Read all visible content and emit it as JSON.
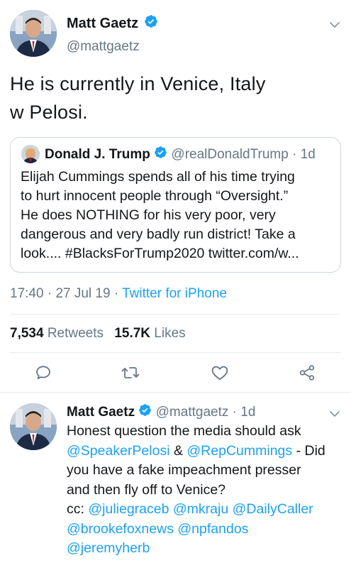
{
  "main_tweet": {
    "author_name": "Matt Gaetz",
    "author_handle": "@mattgaetz",
    "text_line1": "He is currently in Venice, Italy",
    "text_line2": "w Pelosi.",
    "time": "17:40",
    "date": "27 Jul 19",
    "separator": "·",
    "source": "Twitter for iPhone",
    "retweets_count": "7,534",
    "retweets_label": "Retweets",
    "likes_count": "15.7K",
    "likes_label": "Likes"
  },
  "quoted_tweet": {
    "author_name": "Donald J. Trump",
    "author_handle": "@realDonaldTrump",
    "age": "1d",
    "separator": "·",
    "lines": [
      "Elijah Cummings spends all of his time trying",
      "to hurt innocent people through “Oversight.”",
      "He does NOTHING for his very poor, very",
      "dangerous and very badly run district! Take a",
      "look.... #BlacksForTrump2020 twitter.com/w..."
    ]
  },
  "reply_tweet": {
    "author_name": "Matt Gaetz",
    "author_handle": "@mattgaetz",
    "age": "1d",
    "separator": "·",
    "line1": "Honest question the media should ask",
    "line2_mention1": "@SpeakerPelosi",
    "line2_amp": " & ",
    "line2_mention2": "@RepCummings",
    "line2_tail": " - Did",
    "line3": "you have a fake impeachment presser",
    "line4": "and then fly off to Venice?",
    "line5_prefix": "cc: ",
    "line5_mention1": "@juliegraceb",
    "line5_mention2": "@mkraju",
    "line5_mention3": "@DailyCaller",
    "line6_mention1": "@brookefoxnews",
    "line6_mention2": "@npfandos",
    "line7_mention1": "@jeremyherb"
  },
  "icons": {
    "verified": "verified-badge-icon",
    "chevron": "chevron-down-icon",
    "reply": "reply-icon",
    "retweet": "retweet-icon",
    "like": "heart-icon",
    "share": "share-icon"
  },
  "colors": {
    "link": "#1da1f2",
    "secondary_text": "#657786",
    "primary_text": "#14171a",
    "divider": "#e6ecf0"
  }
}
